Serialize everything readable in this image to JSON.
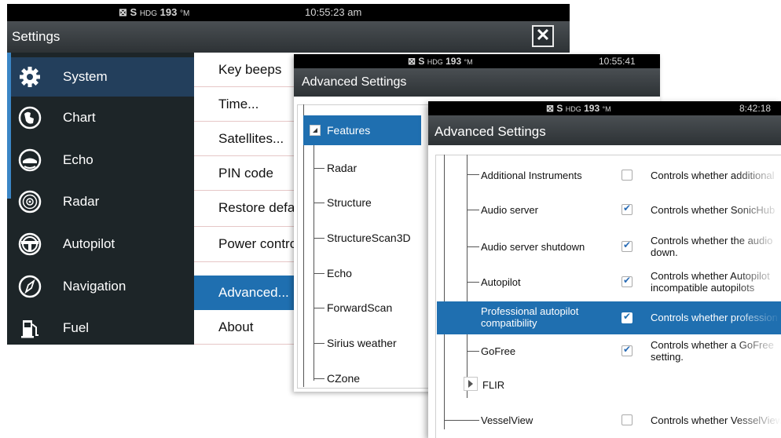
{
  "status": {
    "heading_prefix": "⊠ S",
    "heading_label": "HDG",
    "heading_value": "193",
    "heading_unit": "°M",
    "time_w1": "10:55:23 am",
    "time_w2": "10:55:41",
    "time_w3": "8:42:18"
  },
  "settings": {
    "title": "Settings",
    "close_label": "✕",
    "sidebar": [
      {
        "label": "System",
        "icon": "gear-icon"
      },
      {
        "label": "Chart",
        "icon": "chart-icon"
      },
      {
        "label": "Echo",
        "icon": "echo-icon"
      },
      {
        "label": "Radar",
        "icon": "radar-icon"
      },
      {
        "label": "Autopilot",
        "icon": "steering-wheel-icon"
      },
      {
        "label": "Navigation",
        "icon": "compass-icon"
      },
      {
        "label": "Fuel",
        "icon": "fuel-pump-icon"
      }
    ],
    "list": [
      "Key beeps",
      "Time...",
      "Satellites...",
      "PIN code",
      "Restore defau",
      "Power control",
      "Advanced...",
      "About"
    ]
  },
  "advanced_back": {
    "title": "Advanced Settings",
    "selected": "Features",
    "children": [
      "Radar",
      "Structure",
      "StructureScan3D",
      "Echo",
      "ForwardScan",
      "Sirius weather",
      "CZone"
    ]
  },
  "advanced_front": {
    "title": "Advanced Settings",
    "rows": [
      {
        "name": "Additional Instruments",
        "checked": false,
        "desc": "Controls whether additional"
      },
      {
        "name": "Audio server",
        "checked": true,
        "desc": "Controls whether SonicHub"
      },
      {
        "name": "Audio server shutdown",
        "checked": true,
        "desc": "Controls whether the audio",
        "desc2": "down."
      },
      {
        "name": "Autopilot",
        "checked": true,
        "desc": "Controls whether Autopilot",
        "desc2": "incompatible autopilots"
      },
      {
        "name": "Professional autopilot",
        "name2": "compatibility",
        "checked": true,
        "desc": "Controls whether profession"
      },
      {
        "name": "GoFree",
        "checked": true,
        "desc": "Controls whether a GoFree",
        "desc2": "setting."
      },
      {
        "name": "FLIR"
      },
      {
        "name": "VesselView",
        "checked": false,
        "desc": "Controls whether VesselView"
      }
    ]
  }
}
